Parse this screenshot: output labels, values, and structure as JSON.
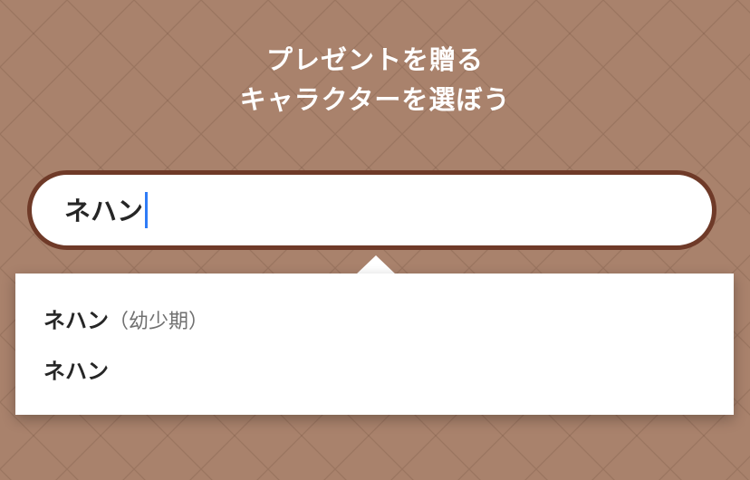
{
  "header": {
    "title_line1": "プレゼントを贈る",
    "title_line2": "キャラクターを選ぼう"
  },
  "search": {
    "value": "ネハン"
  },
  "suggestions": [
    {
      "name": "ネハン",
      "note": "（幼少期）"
    },
    {
      "name": "ネハン",
      "note": ""
    }
  ],
  "colors": {
    "background": "#a9826c",
    "input_border": "#6f3a28",
    "caret": "#2f7cf6"
  }
}
